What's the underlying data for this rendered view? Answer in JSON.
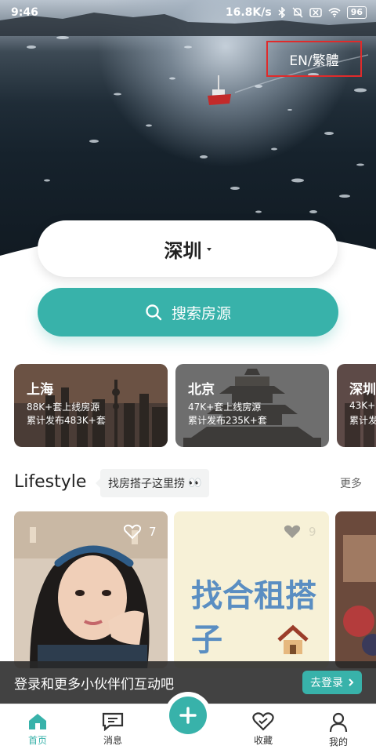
{
  "status_bar": {
    "time": "9:46",
    "network_speed": "16.8K/s",
    "battery": "96"
  },
  "language_toggle": "EN/繁體",
  "city_selector": {
    "city": "深圳"
  },
  "search": {
    "label": "搜索房源"
  },
  "city_cards": [
    {
      "name": "上海",
      "line1": "88K+套上线房源",
      "line2": "累计发布483K+套"
    },
    {
      "name": "北京",
      "line1": "47K+套上线房源",
      "line2": "累计发布235K+套"
    },
    {
      "name": "深圳",
      "line1": "43K+",
      "line2": "累计发"
    }
  ],
  "lifestyle": {
    "title": "Lifestyle",
    "tip": "找房搭子这里捞",
    "tip_emoji": "👀",
    "more": "更多"
  },
  "posts": [
    {
      "likes": "7"
    },
    {
      "likes": "9",
      "text": "找合租搭子"
    }
  ],
  "login_banner": {
    "message": "登录和更多小伙伴们互动吧",
    "button": "去登录"
  },
  "nav": {
    "home": "首页",
    "messages": "消息",
    "favorites": "收藏",
    "mine": "我的"
  },
  "colors": {
    "accent": "#38b2aa",
    "highlight_box": "#e02b2b"
  }
}
